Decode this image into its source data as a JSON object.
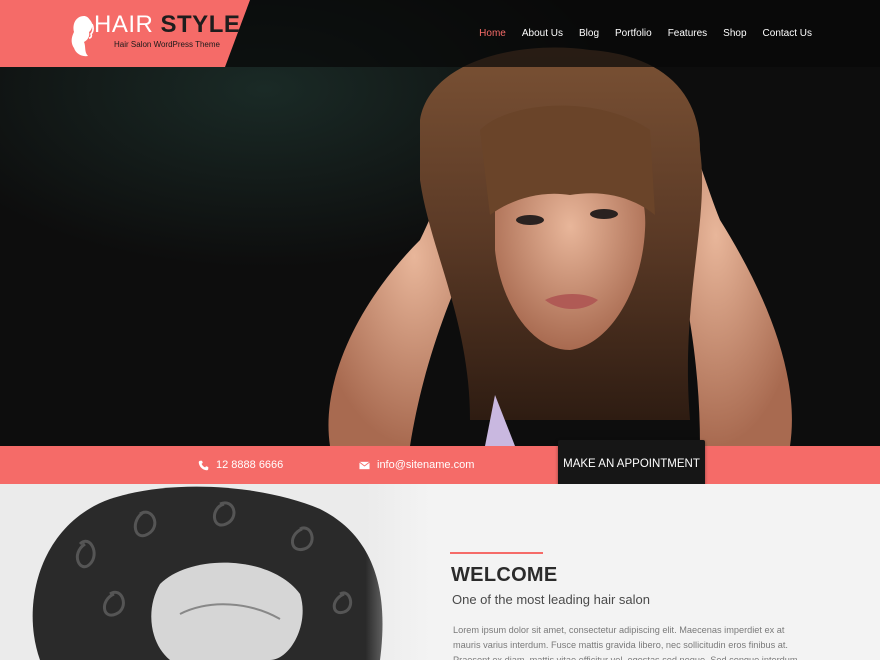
{
  "brand": {
    "title_part1": "HAIR",
    "title_part2": "STYLE",
    "tagline": "Hair Salon WordPress Theme",
    "accent_color": "#f56b68"
  },
  "nav": {
    "items": [
      {
        "label": "Home",
        "active": true
      },
      {
        "label": "About Us",
        "active": false
      },
      {
        "label": "Blog",
        "active": false
      },
      {
        "label": "Portfolio",
        "active": false
      },
      {
        "label": "Features",
        "active": false
      },
      {
        "label": "Shop",
        "active": false
      },
      {
        "label": "Contact Us",
        "active": false
      }
    ]
  },
  "contact_bar": {
    "phone": "12 8888 6666",
    "phone_icon": "phone-icon",
    "email": "info@sitename.com",
    "email_icon": "envelope-icon",
    "appointment_label": "MAKE AN APPOINTMENT"
  },
  "welcome": {
    "title": "WELCOME",
    "subtitle": "One of the most leading hair salon",
    "body": "Lorem ipsum dolor sit amet, consectetur adipiscing elit. Maecenas imperdiet ex at mauris varius interdum. Fusce mattis gravida libero, nec sollicitudin eros finibus at. Praesent ex diam, mattis vitae efficitur vel, egestas sed neque. Sed congue interdum"
  }
}
